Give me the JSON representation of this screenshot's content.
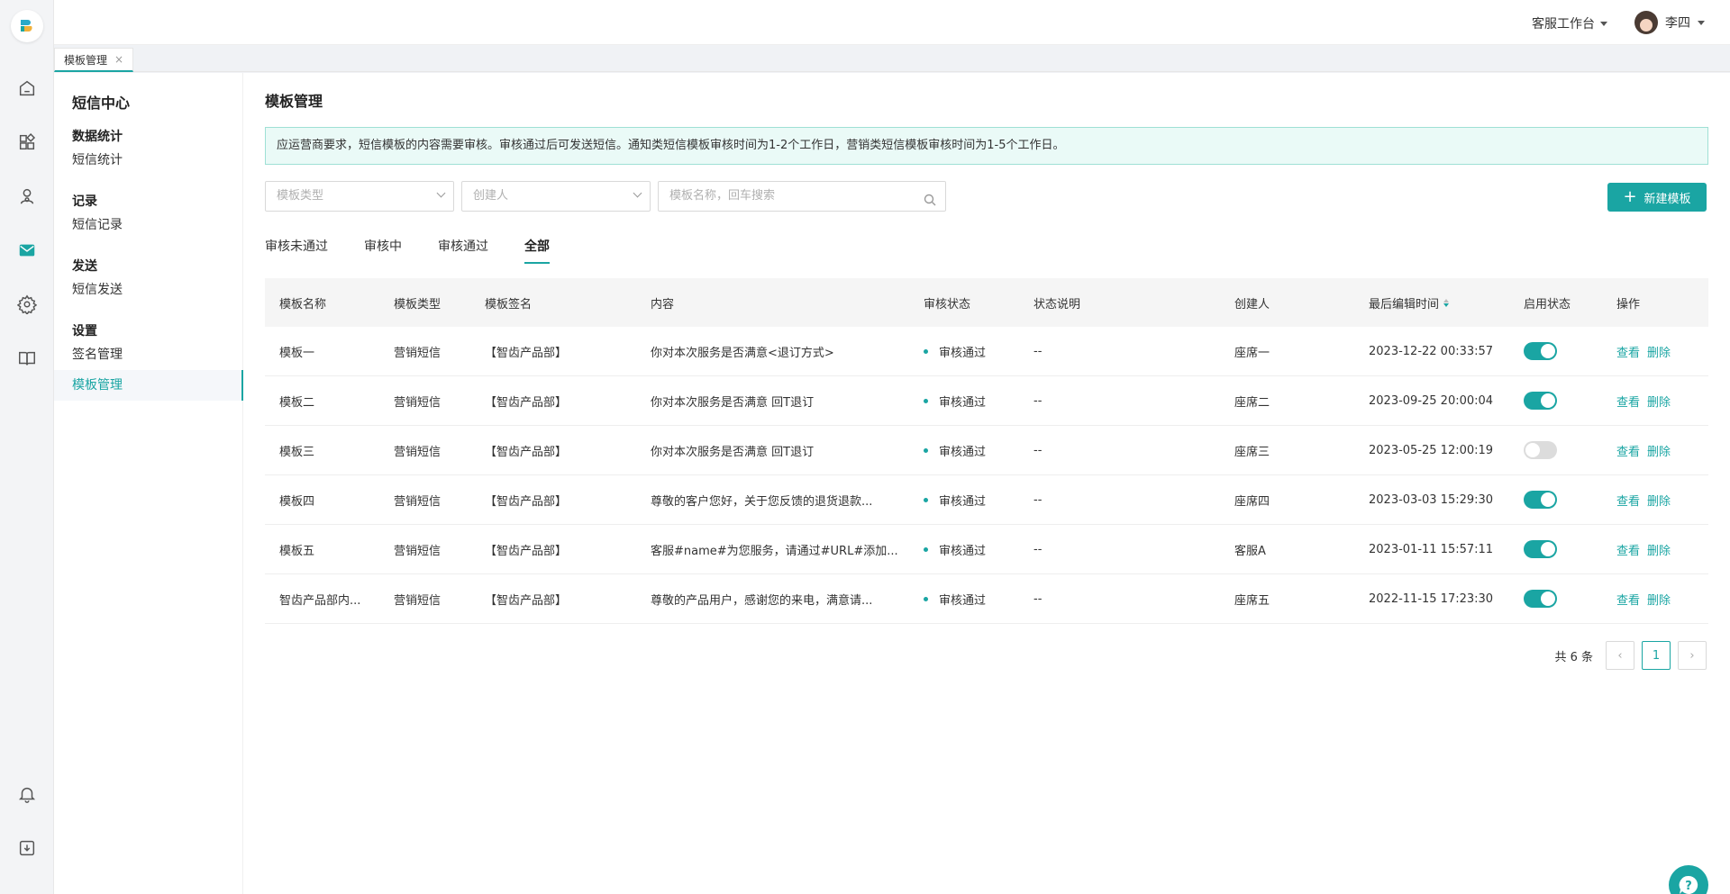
{
  "header": {
    "workbench_label": "客服工作台",
    "user_name": "李四"
  },
  "page_tab": {
    "label": "模板管理",
    "close": "×"
  },
  "menu": {
    "title": "短信中心",
    "groups": [
      {
        "label": "数据统计",
        "items": [
          "短信统计"
        ]
      },
      {
        "label": "记录",
        "items": [
          "短信记录"
        ]
      },
      {
        "label": "发送",
        "items": [
          "短信发送"
        ]
      },
      {
        "label": "设置",
        "items": [
          "签名管理",
          "模板管理"
        ]
      }
    ]
  },
  "main": {
    "title": "模板管理",
    "notice": "应运营商要求，短信模板的内容需要审核。审核通过后可发送短信。通知类短信模板审核时间为1-2个工作日，营销类短信模板审核时间为1-5个工作日。",
    "filters": {
      "type_placeholder": "模板类型",
      "creator_placeholder": "创建人",
      "search_placeholder": "模板名称，回车搜索"
    },
    "new_button": "新建模板",
    "status_tabs": [
      "审核未通过",
      "审核中",
      "审核通过",
      "全部"
    ],
    "active_tab": "全部"
  },
  "table": {
    "columns": [
      "模板名称",
      "模板类型",
      "模板签名",
      "内容",
      "审核状态",
      "状态说明",
      "创建人",
      "最后编辑时间",
      "启用状态",
      "操作"
    ],
    "rows": [
      {
        "name": "模板一",
        "type": "营销短信",
        "sign": "【智齿产品部】",
        "content": "你对本次服务是否满意<退订方式>",
        "status": "审核通过",
        "note": "--",
        "creator": "座席一",
        "time": "2023-12-22 00:33:57",
        "enabled": true
      },
      {
        "name": "模板二",
        "type": "营销短信",
        "sign": "【智齿产品部】",
        "content": "你对本次服务是否满意 回T退订",
        "status": "审核通过",
        "note": "--",
        "creator": "座席二",
        "time": "2023-09-25 20:00:04",
        "enabled": true
      },
      {
        "name": "模板三",
        "type": "营销短信",
        "sign": "【智齿产品部】",
        "content": "你对本次服务是否满意 回T退订",
        "status": "审核通过",
        "note": "--",
        "creator": "座席三",
        "time": "2023-05-25 12:00:19",
        "enabled": false
      },
      {
        "name": "模板四",
        "type": "营销短信",
        "sign": "【智齿产品部】",
        "content": "尊敬的客户您好，关于您反馈的退货退款...",
        "status": "审核通过",
        "note": "--",
        "creator": "座席四",
        "time": "2023-03-03 15:29:30",
        "enabled": true
      },
      {
        "name": "模板五",
        "type": "营销短信",
        "sign": "【智齿产品部】",
        "content": "客服#name#为您服务，请通过#URL#添加...",
        "status": "审核通过",
        "note": "--",
        "creator": "客服A",
        "time": "2023-01-11 15:57:11",
        "enabled": true
      },
      {
        "name": "智齿产品部内...",
        "type": "营销短信",
        "sign": "【智齿产品部】",
        "content": "尊敬的产品用户，感谢您的来电，满意请...",
        "status": "审核通过",
        "note": "--",
        "creator": "座席五",
        "time": "2022-11-15 17:23:30",
        "enabled": true
      }
    ],
    "actions": [
      "查看",
      "删除"
    ]
  },
  "pagination": {
    "total_text": "共 6 条",
    "current_page": "1",
    "prev": "‹",
    "next": "›"
  },
  "colors": {
    "accent": "#1aa5a3",
    "notice_bg": "#eafaf7"
  },
  "icons": [
    "logo",
    "home-icon",
    "apps-icon",
    "contacts-icon",
    "mail-icon",
    "gear-icon",
    "book-icon",
    "bell-icon",
    "download-icon",
    "search-icon",
    "help-chat-icon"
  ]
}
